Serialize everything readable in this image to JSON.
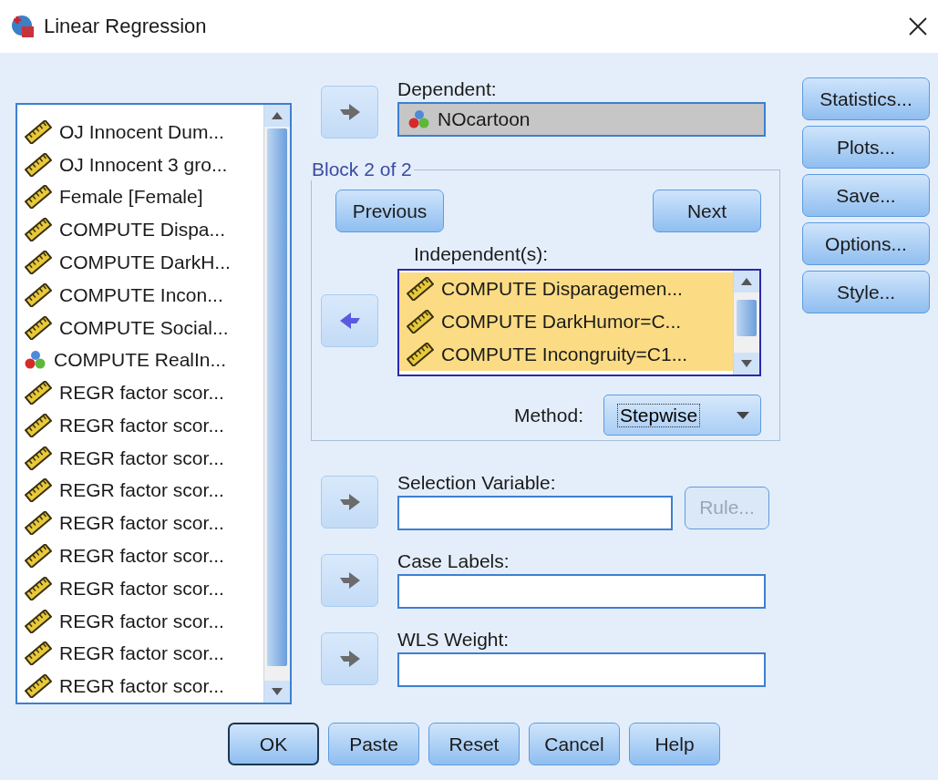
{
  "window": {
    "title": "Linear Regression"
  },
  "variables": [
    {
      "label": "OJ Innocent Dum...",
      "kind": "scale",
      "selected": false
    },
    {
      "label": "OJ Innocent 3 gro...",
      "kind": "scale",
      "selected": false
    },
    {
      "label": "Female [Female]",
      "kind": "scale",
      "selected": false
    },
    {
      "label": "COMPUTE Dispa...",
      "kind": "scale",
      "selected": false
    },
    {
      "label": "COMPUTE DarkH...",
      "kind": "scale",
      "selected": false
    },
    {
      "label": "COMPUTE Incon...",
      "kind": "scale",
      "selected": false
    },
    {
      "label": "COMPUTE Social...",
      "kind": "scale",
      "selected": false
    },
    {
      "label": "COMPUTE RealIn...",
      "kind": "nominal",
      "selected": false
    },
    {
      "label": "REGR factor scor...",
      "kind": "scale",
      "selected": false
    },
    {
      "label": "REGR factor scor...",
      "kind": "scale",
      "selected": false
    },
    {
      "label": "REGR factor scor...",
      "kind": "scale",
      "selected": false
    },
    {
      "label": "REGR factor scor...",
      "kind": "scale",
      "selected": false
    },
    {
      "label": "REGR factor scor...",
      "kind": "scale",
      "selected": false
    },
    {
      "label": "REGR factor scor...",
      "kind": "scale",
      "selected": false
    },
    {
      "label": "REGR factor scor...",
      "kind": "scale",
      "selected": false
    },
    {
      "label": "REGR factor scor...",
      "kind": "scale",
      "selected": false
    },
    {
      "label": "REGR factor scor...",
      "kind": "scale",
      "selected": false
    },
    {
      "label": "REGR factor scor...",
      "kind": "scale",
      "selected": false
    }
  ],
  "dependent": {
    "label": "Dependent:",
    "value": "NOcartoon",
    "kind": "nominal",
    "arrow": {
      "kind": "right",
      "active": false
    }
  },
  "block": {
    "title": "Block 2 of 2",
    "buttons": [
      {
        "label": "Previous"
      },
      {
        "label": "Next"
      }
    ],
    "independents_label": "Independent(s):",
    "arrow": {
      "kind": "left",
      "active": true
    },
    "independents": [
      {
        "label": "COMPUTE Disparagemen...",
        "kind": "scale",
        "selected": true
      },
      {
        "label": "COMPUTE DarkHumor=C...",
        "kind": "scale",
        "selected": true
      },
      {
        "label": "COMPUTE Incongruity=C1...",
        "kind": "scale",
        "selected": true
      }
    ],
    "method": {
      "label": "Method:",
      "value": "Stepwise"
    }
  },
  "fields": [
    {
      "label": "Selection Variable:",
      "arrow": {
        "kind": "right",
        "active": false
      },
      "rule": {
        "label": "Rule...",
        "disabled": true
      }
    },
    {
      "label": "Case Labels:",
      "arrow": {
        "kind": "right",
        "active": false
      }
    },
    {
      "label": "WLS Weight:",
      "arrow": {
        "kind": "right",
        "active": false
      }
    }
  ],
  "side_buttons": [
    "Statistics...",
    "Plots...",
    "Save...",
    "Options...",
    "Style..."
  ],
  "footer_buttons": [
    {
      "label": "OK",
      "default": true
    },
    {
      "label": "Paste",
      "default": false
    },
    {
      "label": "Reset",
      "default": false
    },
    {
      "label": "Cancel",
      "default": false
    },
    {
      "label": "Help",
      "default": false
    }
  ]
}
